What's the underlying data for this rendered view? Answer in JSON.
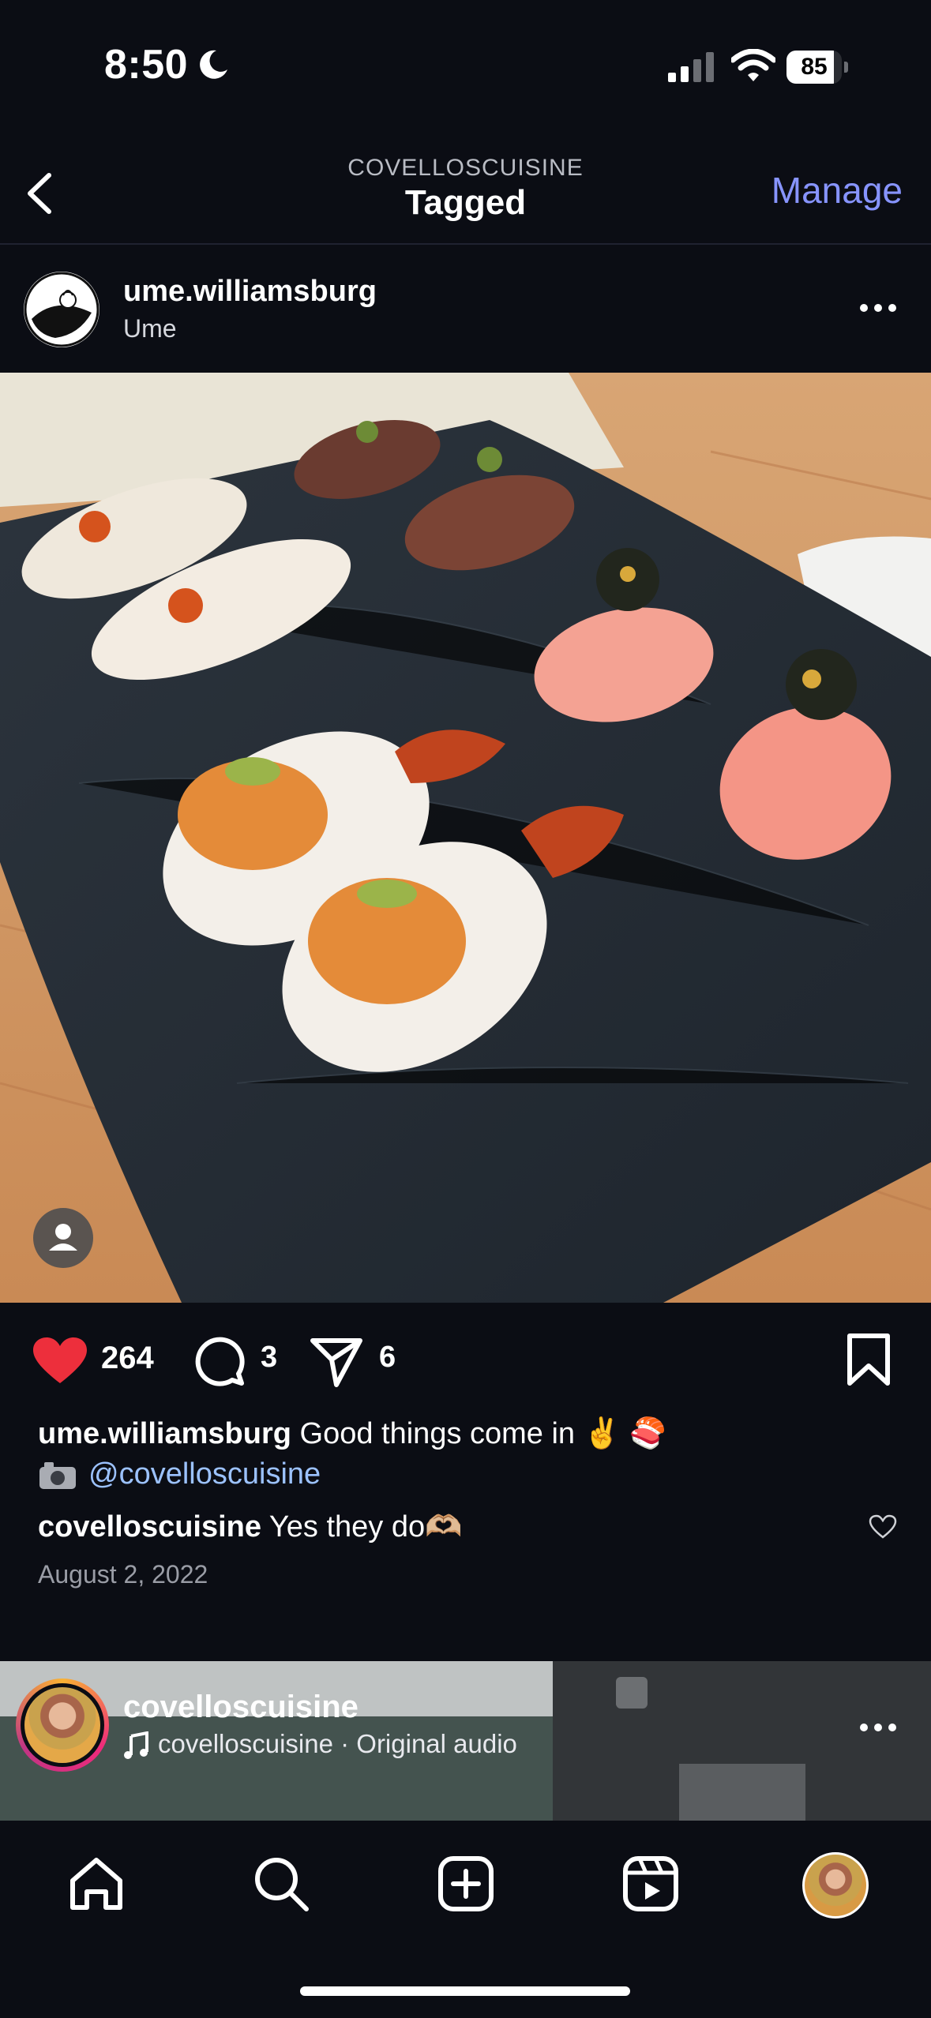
{
  "status_bar": {
    "time": "8:50",
    "battery": "85",
    "battery_level": 0.85
  },
  "header": {
    "subtitle": "COVELLOSCUISINE",
    "title": "Tagged",
    "manage_label": "Manage"
  },
  "post": {
    "username": "ume.williamsburg",
    "location": "Ume",
    "likes": "264",
    "comments": "3",
    "shares": "6",
    "caption_user": "ume.williamsburg",
    "caption_text": "Good things come in ✌️ 🍣",
    "caption_mention": "@covelloscuisine",
    "comment_user": "covelloscuisine",
    "comment_text": "Yes they do🫶🏼",
    "date": "August 2, 2022"
  },
  "next_post": {
    "username": "covelloscuisine",
    "audio": "covelloscuisine · Original audio"
  },
  "colors": {
    "accent": "#8794ff",
    "like": "#ed2f3c",
    "mention": "#9cc2ff",
    "background": "#0b0d14"
  },
  "icons": [
    "back-icon",
    "more-icon",
    "heart-icon",
    "comment-icon",
    "share-icon",
    "bookmark-icon",
    "camera-icon",
    "music-icon",
    "home-icon",
    "search-icon",
    "create-icon",
    "reels-icon"
  ]
}
